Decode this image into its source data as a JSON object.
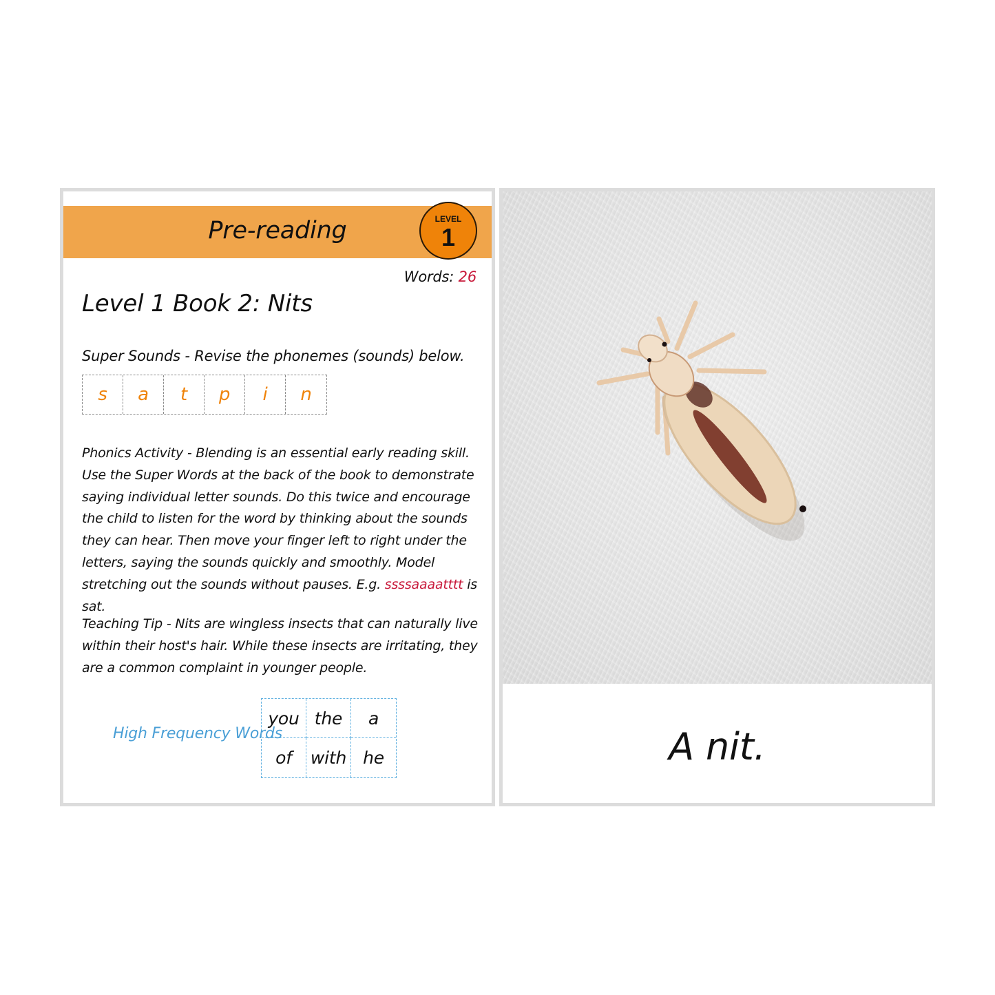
{
  "teacher_card": {
    "banner_title": "Pre-reading",
    "level_badge": {
      "word": "LEVEL",
      "number": "1"
    },
    "words_count": {
      "label": "Words:",
      "value": "26"
    },
    "book_title": "Level 1 Book 2: Nits",
    "super_sounds": {
      "label": "Super Sounds - Revise the phonemes (sounds) below.",
      "phonemes": [
        "s",
        "a",
        "t",
        "p",
        "i",
        "n"
      ]
    },
    "phonics_activity": {
      "text": "Phonics Activity - Blending is an essential early reading skill. Use the Super Words at the back of the book to demonstrate saying individual letter sounds. Do this twice and encourage the child to listen for the word by thinking about the sounds they can hear. Then move your finger left to right under the letters, saying the sounds quickly and smoothly. Model stretching out the sounds without pauses. E.g.",
      "example": "ssssaaaatttt",
      "suffix": "is sat."
    },
    "teaching_tip": "Teaching Tip - Nits are wingless insects that can naturally live within their host's hair. While these insects are irritating, they are a common complaint in younger people.",
    "high_frequency_words": {
      "label": "High Frequency Words",
      "rows": [
        [
          "you",
          "the",
          "a"
        ],
        [
          "of",
          "with",
          "he"
        ]
      ]
    }
  },
  "story_card": {
    "photo_subject": "head louse (nit) on white textured surface",
    "caption": "A nit."
  },
  "colors": {
    "banner": "#f0a54b",
    "badge": "#ef8309",
    "phoneme_text": "#ef8309",
    "highlight_red": "#c8193a",
    "hfw_blue": "#4a9fd6",
    "card_border": "#dcdcdc"
  }
}
